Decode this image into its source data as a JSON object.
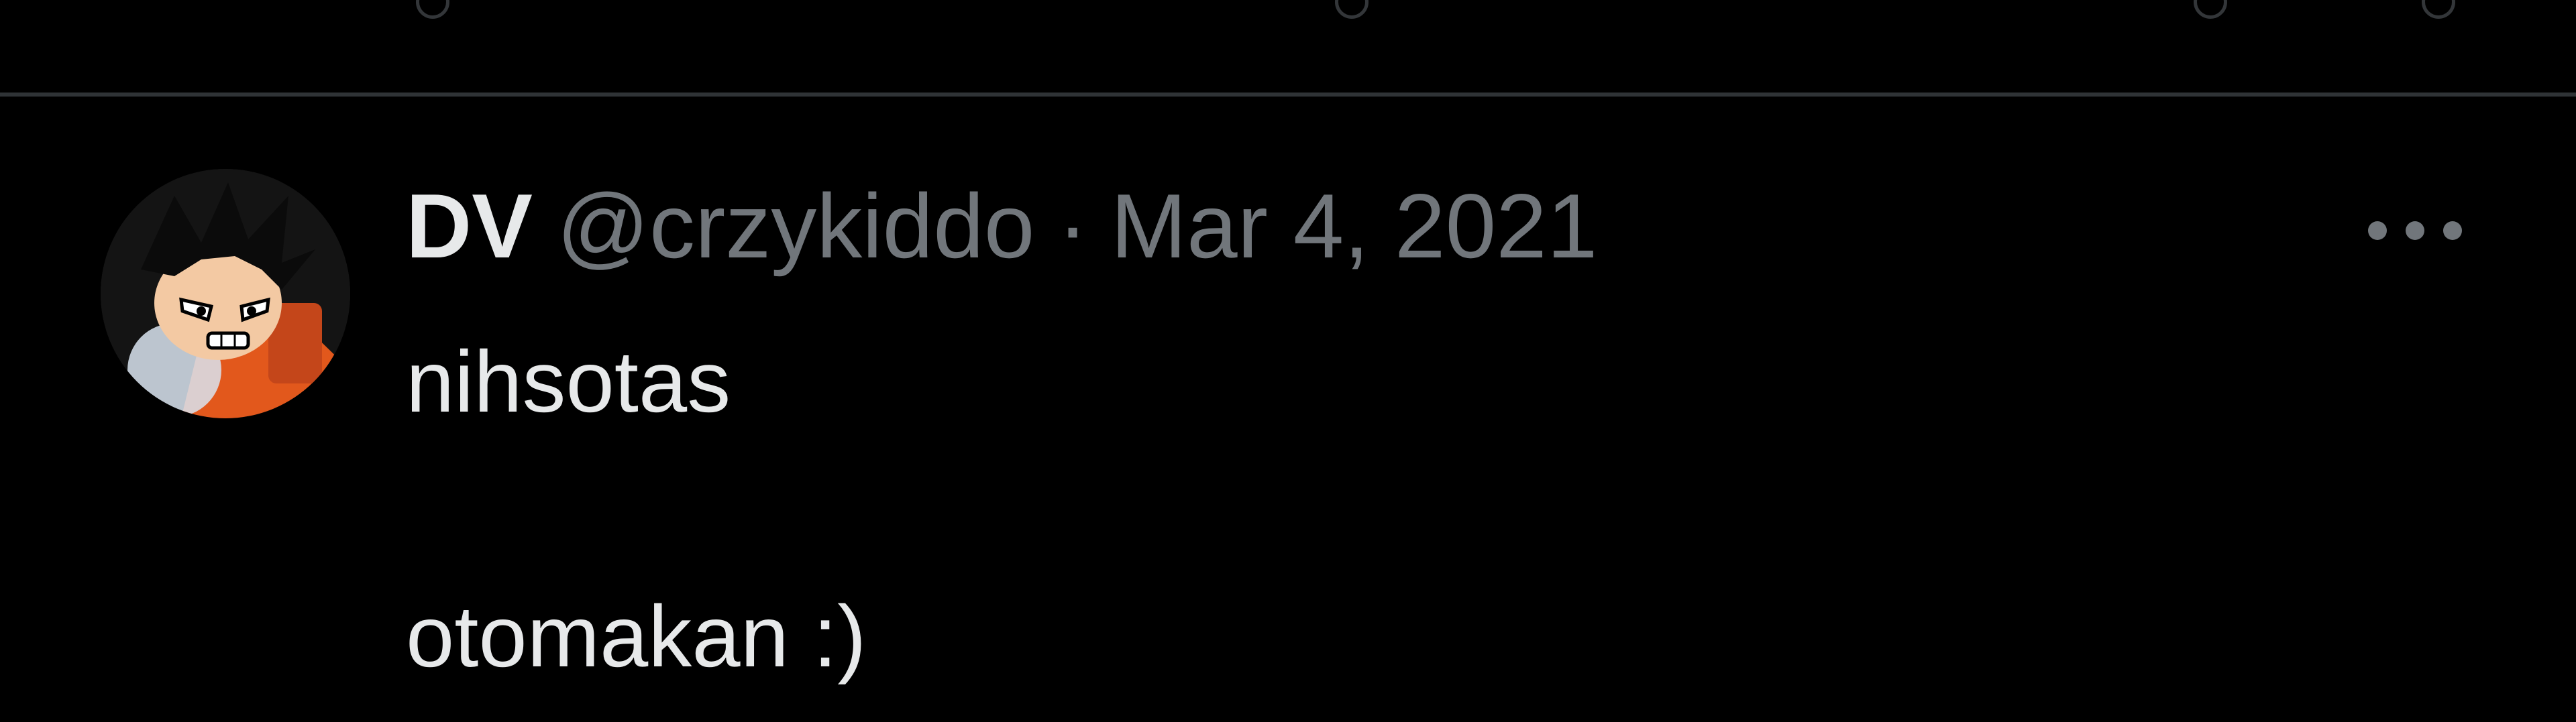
{
  "tweet": {
    "display_name": "DV",
    "handle": "@crzykiddo",
    "separator": "·",
    "timestamp": "Mar 4, 2021",
    "text_line_1": "nihsotas",
    "text_line_2": "otomakan :)",
    "avatar_icon": "avatar-cartoon-boy-icon",
    "more_icon": "more-options-icon"
  },
  "colors": {
    "background": "#000000",
    "primary_text": "#e7e9ea",
    "secondary_text": "#71767b",
    "divider": "#2f3336"
  }
}
